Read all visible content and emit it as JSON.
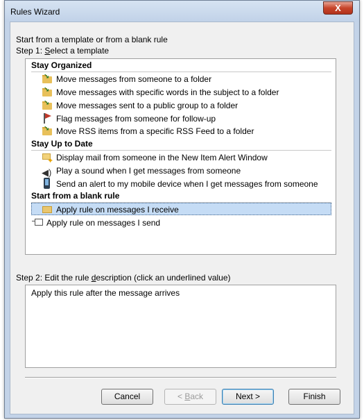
{
  "window": {
    "title": "Rules Wizard",
    "close_label": "X"
  },
  "intro": {
    "line1": "Start from a template or from a blank rule",
    "step1_prefix": "Step 1: ",
    "step1_accel": "S",
    "step1_rest": "elect a template"
  },
  "groups": [
    {
      "title": "Stay Organized",
      "items": [
        {
          "label": "Move messages from someone to a folder",
          "icon": "move-folder-icon"
        },
        {
          "label": "Move messages with specific words in the subject to a folder",
          "icon": "move-folder-icon"
        },
        {
          "label": "Move messages sent to a public group to a folder",
          "icon": "move-folder-icon"
        },
        {
          "label": "Flag messages from someone for follow-up",
          "icon": "flag-icon"
        },
        {
          "label": "Move RSS items from a specific RSS Feed to a folder",
          "icon": "move-folder-icon"
        }
      ]
    },
    {
      "title": "Stay Up to Date",
      "items": [
        {
          "label": "Display mail from someone in the New Item Alert Window",
          "icon": "alert-icon"
        },
        {
          "label": "Play a sound when I get messages from someone",
          "icon": "speaker-icon"
        },
        {
          "label": "Send an alert to my mobile device when I get messages from someone",
          "icon": "mobile-icon"
        }
      ]
    },
    {
      "title": "Start from a blank rule",
      "items": [
        {
          "label": "Apply rule on messages I receive",
          "icon": "inbox-icon",
          "selected": true
        },
        {
          "label": "Apply rule on messages I send",
          "icon": "send-icon"
        }
      ]
    }
  ],
  "step2": {
    "prefix": "Step 2: Edit the rule ",
    "accel": "d",
    "rest": "escription (click an underlined value)",
    "description": "Apply this rule after the message arrives"
  },
  "buttons": {
    "cancel": "Cancel",
    "back_prefix": "< ",
    "back_accel": "B",
    "back_rest": "ack",
    "next": "Next >",
    "finish": "Finish"
  }
}
